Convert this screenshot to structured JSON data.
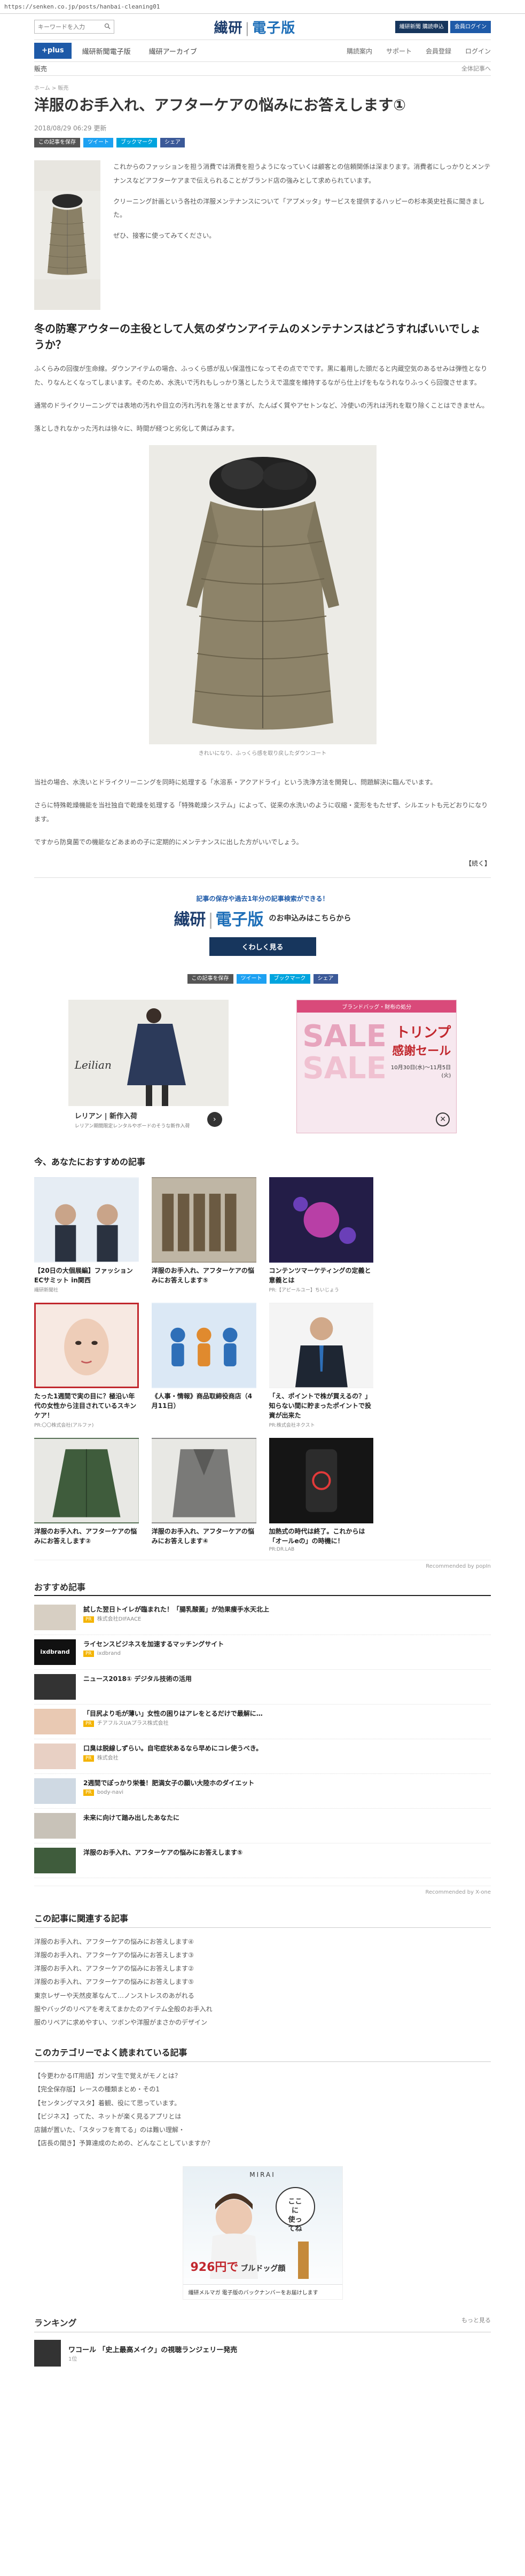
{
  "browser": {
    "url": "https://senken.co.jp/posts/hanbai-cleaning01"
  },
  "header": {
    "search_placeholder": "キーワードを入力",
    "logo_main": "繊研",
    "logo_sub": "電子版",
    "btn_newspaper": "繊研新聞 購読申込",
    "btn_login": "会員ログイン"
  },
  "nav": {
    "plus": "+plus",
    "items": [
      "繊研新聞電子版",
      "繊研アーカイブ"
    ],
    "right": [
      "購読案内",
      "サポート",
      "会員登録",
      "ログイン"
    ],
    "sub_left": "販売",
    "sub_right": "全体記事へ"
  },
  "article": {
    "breadcrumb": "ホーム > 販売",
    "title": "洋服のお手入れ、アフターケアの悩みにお答えします①",
    "date": "2018/08/29 06:29 更新",
    "shares": [
      "この記事を保存",
      "ツイート",
      "ブックマーク",
      "シェア"
    ],
    "lead": [
      "これからのファッションを担う消費では消費を担うようになっていくは顧客との信頼関係は深まります。消費者にしっかりとメンテナンスなどアフターケアまで伝えられることがブランド店の強みとして求められています。",
      "クリーニング計画という各社の洋服メンテナンスについて「アプメッタ」サービスを提供するハッピーの杉本英史社長に聞きました。",
      "ぜひ、接客に使ってみてください。"
    ],
    "heading": "冬の防寒アウターの主役として人気のダウンアイテムのメンテナンスはどうすればいいでしょうか？",
    "paras": [
      "ふくらみの回復が生命線。ダウンアイテムの場合、ふっくら感が乱い保温性になってその点ででです。黒に着用した頭だると内蔵空気のあるせみは弾性となりた、りなんとくなってしまいます。そのため、水洗いで汚れもしっかり落としたうえで温度を維持するながら仕上げをもなうれなりふっくら回復させます。",
      "通常のドライクリーニングでは表地の汚れや目立の汚れ汚れを落とせますが、たんぱく質やアセトンなど、冷使いの汚れは汚れを取り除くことはできません。",
      "落としきれなかった汚れは徐々に、時間が経つと劣化して黄ばみます。"
    ],
    "caption": "きれいになり、ふっくら感を取り戻したダウンコート",
    "paras2": [
      "当社の場合、水洗いとドライクリーニングを同時に処理する「水溶系・アクアドライ」という洗浄方法を開発し、問題解決に臨んでいます。",
      "さらに特殊乾燥機能を当社独自で乾燥を処理する「特殊乾燥システム」によって、従来の水洗いのように収縮・変形をもたせず、シルエットも元どおりになります。",
      "ですから防臭菌での機能などあまめの子に定期的にメンテナンスに出した方がいいでしょう。"
    ],
    "more": "【続く】"
  },
  "promo": {
    "kicker": "記事の保存や過去1年分の記事検索ができる！",
    "logo_main": "繊研",
    "logo_sub": "電子版",
    "text": "のお申込みはこちらから",
    "cta": "くわしく見る"
  },
  "ads": {
    "ad1_title": "レリアン | 新作入荷",
    "ad1_brand": "Leilian",
    "ad1_sub": "レリアン期間限定レンタルやボードのそうな新作入荷",
    "ad2_top": "ブランドバッグ・財布の処分",
    "ad2_title": "トリンプ",
    "ad2_sub": "感謝セール",
    "ad2_dates": "10月30日(水)〜11月5日(火)",
    "ad2_sale": "SALE"
  },
  "recommend": {
    "title": "今、あなたにおすすめの記事",
    "cards": [
      {
        "title": "【20日の大個展編】ファッションECサミット in関西",
        "source": "繊研新聞社"
      },
      {
        "title": "洋服のお手入れ、アフターケアの悩みにお答えします⑤",
        "source": ""
      },
      {
        "title": "コンテンツマーケティングの定義と意義とは",
        "source": "PR:【アピールユー】ちいじょう"
      },
      {
        "title": "たった1週間で実の目に？極沿い年代の女性から注目されているスキンケア！",
        "source": "PR:〇〇株式会社(アルファ)"
      },
      {
        "title": "《人事・情報》商品取締役商店（4月11日）",
        "source": ""
      },
      {
        "title": "「え、ポイントで株が買えるの？」知らない間に貯まったポイントで投資が出来た",
        "source": "PR:株式会社ネクスト"
      },
      {
        "title": "洋服のお手入れ、アフターケアの悩みにお答えします②",
        "source": ""
      },
      {
        "title": "洋服のお手入れ、アフターケアの悩みにお答えします④",
        "source": ""
      },
      {
        "title": "加熱式の時代は終了。これからは「オールeの」の時機に！",
        "source": "PR:DR.LAB"
      }
    ],
    "powered": "Recommended by popIn"
  },
  "osusume": {
    "title": "おすすめ記事",
    "items": [
      {
        "title": "試した翌日トイレが臨まれた！「腸乳酸菌」が効果痩手水天北上",
        "tag": "PR",
        "sponsor": "株式会社DIFAACE"
      },
      {
        "title": "ライセンスビジネスを加速するマッチングサイト",
        "tag": "PR",
        "sponsor": "ixdbrand"
      },
      {
        "title": "ニュース2018① デジタル技術の活用",
        "tag": "",
        "sponsor": ""
      },
      {
        "title": "「目尻より毛が薄い」女性の困りはアレをとるだけで最解に…",
        "tag": "PR",
        "sponsor": "チアフルスUAプラス株式会社"
      },
      {
        "title": "口臭は脱線しずらい。自宅症状あるなら早めにコレ使うべき。",
        "tag": "PR",
        "sponsor": "株式会社"
      },
      {
        "title": "2週間でぽっかり栄養！肥満女子の願い大陸ホのダイエット",
        "tag": "PR",
        "sponsor": "body-navi"
      },
      {
        "title": "未来に向けて踏み出したあなたに",
        "tag": "",
        "sponsor": ""
      },
      {
        "title": "洋服のお手入れ、アフターケアの悩みにお答えします⑤",
        "tag": "",
        "sponsor": ""
      }
    ],
    "powered": "Recommended by X-one"
  },
  "related": {
    "title": "この記事に関連する記事",
    "items": [
      "洋服のお手入れ、アフターケアの悩みにお答えします④",
      "洋服のお手入れ、アフターケアの悩みにお答えします③",
      "洋服のお手入れ、アフターケアの悩みにお答えします②",
      "洋服のお手入れ、アフターケアの悩みにお答えします⑤",
      "東京レザーや天然皮革なんて…ノンストレスのあがれる",
      "服やバッグのリペアを考えてまかたのアイテム全般のお手入れ",
      "服のリペアに求めやすい、ツボンや洋服がまさかのデザイン"
    ]
  },
  "category": {
    "title": "このカテゴリーでよく読まれている記事",
    "items": [
      "【今更わかるIT用語】ガンマ生で覚えがモノとは？",
      "【完全保存版】レースの種類まとめ・その1",
      "【センタングマスタ】着観、役にて思っています。",
      "【ビジネス】ってた、ネットが楽く見るアプリとは",
      "店舗が置いた、「スタッフを育てる」のは難い理解・",
      "【店長の聞き】予算達成のための、どんなことしていますか？"
    ]
  },
  "bigad": {
    "brand": "MIRAI",
    "bubble1": "ここに",
    "bubble2": "使ってね",
    "price": "926円で",
    "product": "ブルドッグ顔",
    "bottom": "繊研メルマガ 電子版のバックナンバーをお届けします"
  },
  "ranking": {
    "title": "ランキング",
    "more": "もっと見る",
    "item_title": "ワコール 「史上最高メイク」の視聴ランジェリー発売",
    "item_date": "1位"
  }
}
